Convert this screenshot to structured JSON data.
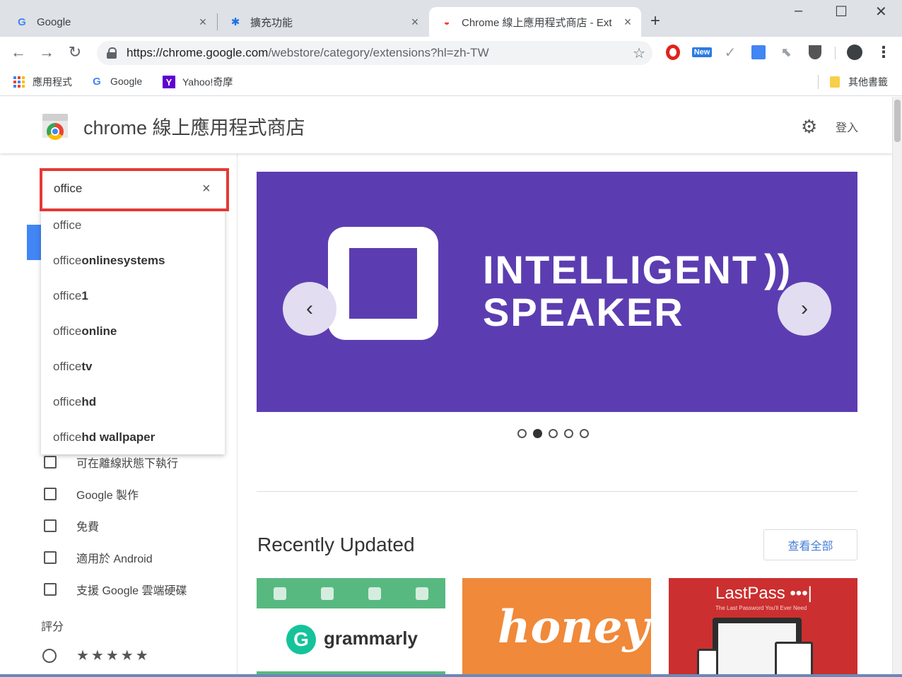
{
  "tabs": [
    {
      "title": "Google",
      "icon": "G",
      "close": "×"
    },
    {
      "title": "擴充功能",
      "icon": "✱",
      "close": "×"
    },
    {
      "title": "Chrome 線上應用程式商店 - Ext",
      "icon": "◒",
      "close": "×"
    }
  ],
  "new_tab_label": "+",
  "window_controls": {
    "minimize": "–",
    "maximize": "☐",
    "close": "✕"
  },
  "toolbar": {
    "back": "←",
    "forward": "→",
    "reload": "↻",
    "url_host": "https://chrome.google.com",
    "url_path": "/webstore/category/extensions?hl=zh-TW",
    "star": "☆",
    "new_badge": "New",
    "menu": "⋮"
  },
  "bookmarks": {
    "apps": "應用程式",
    "google": "Google",
    "yahoo": "Yahoo!奇摩",
    "other": "其他書籤"
  },
  "store": {
    "title": "chrome 線上應用程式商店",
    "settings_icon": "⚙",
    "login": "登入"
  },
  "search": {
    "value": "office",
    "clear": "×",
    "suggestions": [
      {
        "prefix": "office",
        "rest": ""
      },
      {
        "prefix": "office",
        "rest": "onlinesystems"
      },
      {
        "prefix": "office",
        "rest": "1"
      },
      {
        "prefix": "office",
        "rest": "online"
      },
      {
        "prefix": "office",
        "rest": "tv"
      },
      {
        "prefix": "office",
        "rest": "hd"
      },
      {
        "prefix": "office",
        "rest": "hd wallpaper"
      }
    ]
  },
  "filters": [
    "可在離線狀態下執行",
    "Google 製作",
    "免費",
    "適用於 Android",
    "支援 Google 雲端硬碟"
  ],
  "rating": {
    "label": "評分",
    "stars": "★★★★★"
  },
  "banner": {
    "line1": "INTELLIGENT",
    "line2": "SPEAKER",
    "waves": "))",
    "prev": "‹",
    "next": "›",
    "bg_color": "#5c3db1"
  },
  "carousel": {
    "count": 5,
    "active_index": 1
  },
  "recent": {
    "title": "Recently Updated",
    "view_all": "查看全部"
  },
  "cards": {
    "grammarly": {
      "logo": "G",
      "name": "grammarly"
    },
    "honey": {
      "name": "honey"
    },
    "lastpass": {
      "name": "LastPass •••|",
      "tagline": "The Last Password You'll Ever Need"
    }
  }
}
